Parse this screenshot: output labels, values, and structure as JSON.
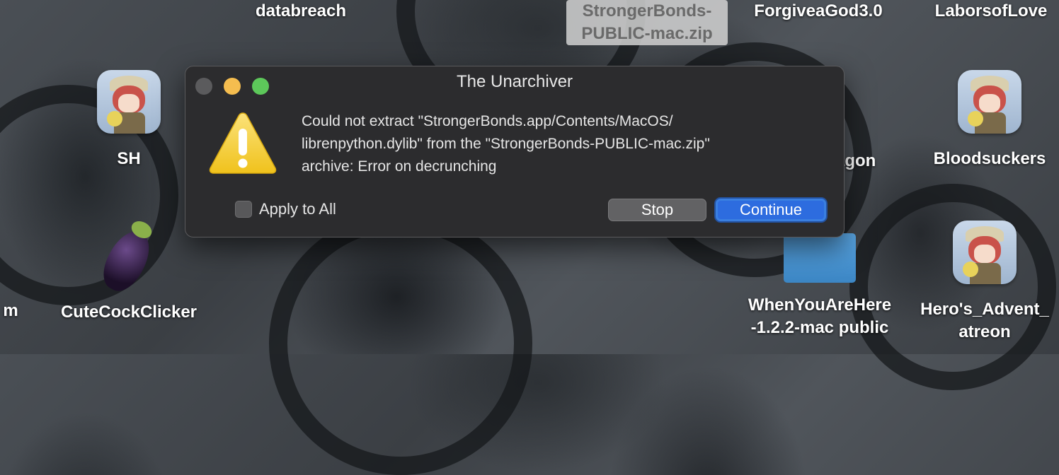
{
  "desktop": {
    "icons": [
      {
        "label": "databreach"
      },
      {
        "label_line1": "StrongerBonds-",
        "label_line2": "PUBLIC-mac.zip"
      },
      {
        "label": "ForgiveaGod3.0"
      },
      {
        "label": "LaborsofLove"
      },
      {
        "label": "SH"
      },
      {
        "label": "agon"
      },
      {
        "label": "Bloodsuckers"
      },
      {
        "label": "m"
      },
      {
        "label": "CuteCockClicker"
      },
      {
        "label_line1": "WhenYouAreHere",
        "label_line2": "-1.2.2-mac public"
      },
      {
        "label_line1": "Hero's_Advent_",
        "label_line2": "atreon"
      }
    ]
  },
  "dialog": {
    "title": "The Unarchiver",
    "message": "Could not extract \"StrongerBonds.app/Contents/MacOS/\nlibrenpython.dylib\" from the \"StrongerBonds-PUBLIC-mac.zip\"\narchive: Error on decrunching",
    "apply_to_all_label": "Apply to All",
    "apply_to_all_checked": false,
    "stop_label": "Stop",
    "continue_label": "Continue"
  },
  "colors": {
    "accent_button": "#2d6cdf",
    "dialog_bg": "#2c2c2e",
    "warning_yellow": "#f5cc2c"
  }
}
